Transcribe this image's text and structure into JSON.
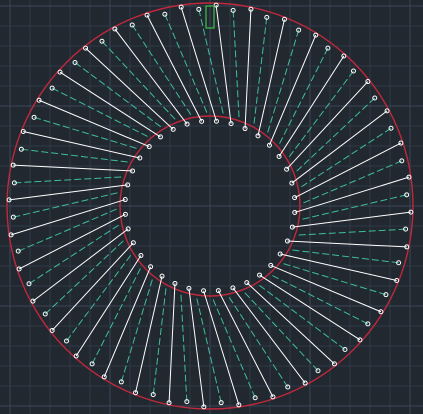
{
  "canvas": {
    "background_color": "#212830",
    "grid_color": "#2f3947",
    "grid_major_color": "#3a4656"
  },
  "drawing": {
    "outer_circle_color": "#c0283c",
    "inner_circle_color": "#c0283c",
    "solid_spoke_color": "#ffffff",
    "dashed_spoke_color": "#3fbf9a",
    "point_marker_color": "#ffffff",
    "marker_color": "#3fbf4a",
    "spoke_count": 36
  }
}
